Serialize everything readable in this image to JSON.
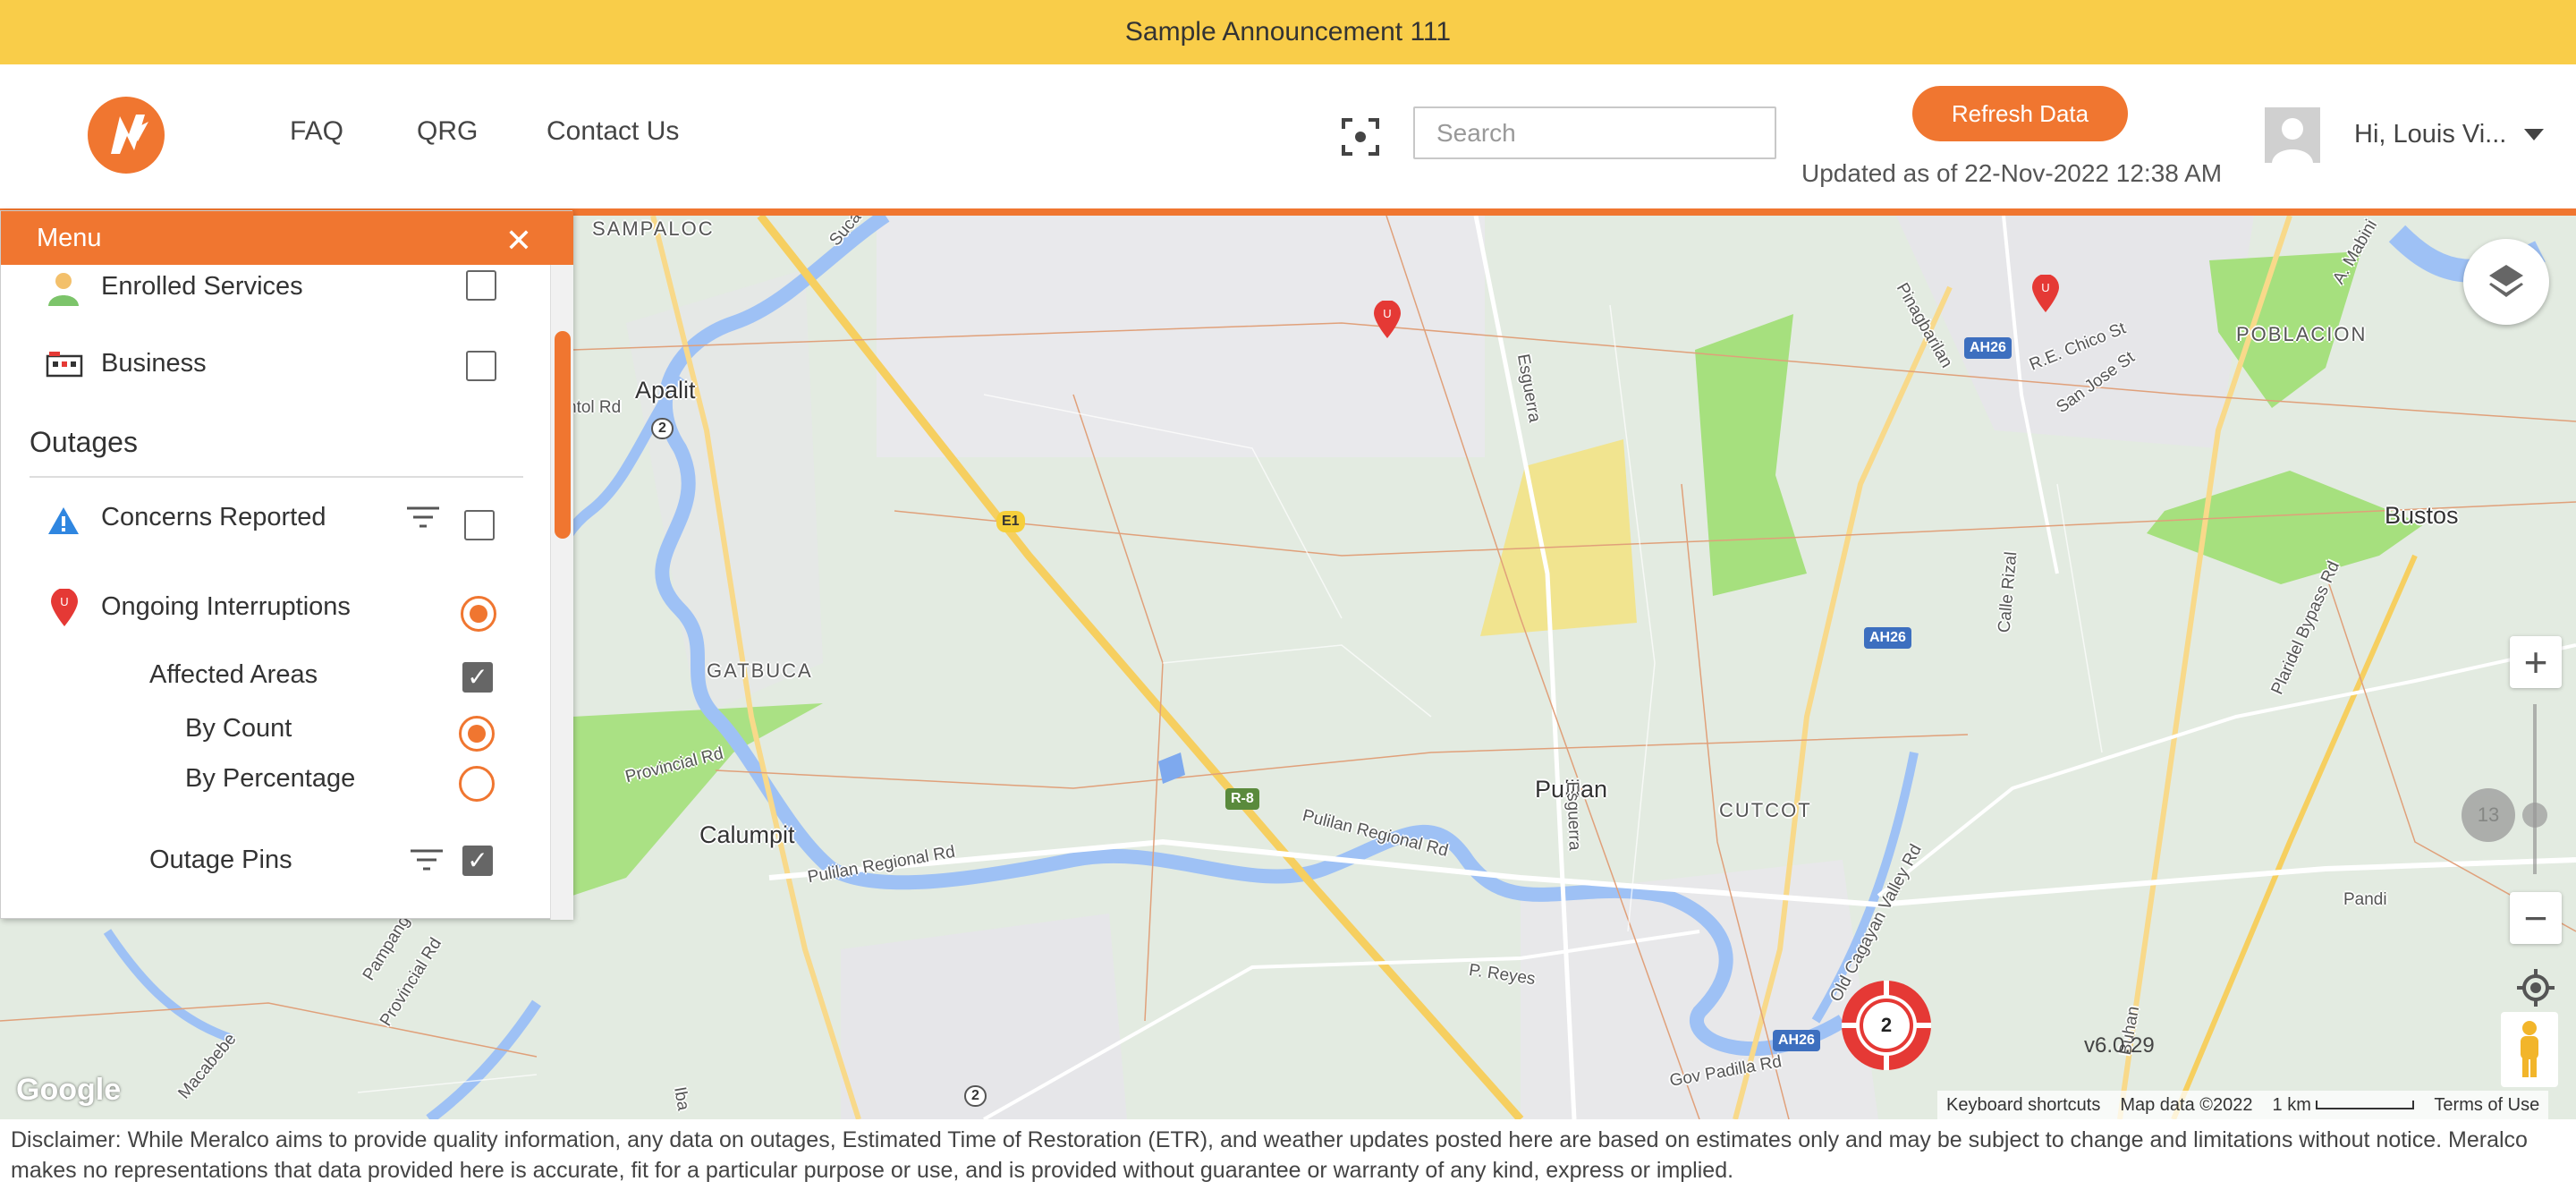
{
  "announcement": "Sample Announcement 111",
  "nav": {
    "faq": "FAQ",
    "qrg": "QRG",
    "contact": "Contact Us"
  },
  "search": {
    "placeholder": "Search",
    "value": ""
  },
  "refresh_label": "Refresh Data",
  "updated_text": "Updated as of 22-Nov-2022 12:38 AM",
  "user": {
    "greeting": "Hi, Louis Vi..."
  },
  "colors": {
    "brand_orange": "#f07630",
    "announcement_bg": "#f9cd49"
  },
  "icons": [
    "meralco-logo",
    "scan-icon",
    "avatar",
    "chevron-down-icon",
    "close-icon",
    "person-icon",
    "business-icon",
    "warning-icon",
    "filter-icon",
    "outage-pin-icon",
    "layers-icon",
    "locate-icon",
    "pegman-icon"
  ],
  "menu": {
    "title": "Menu",
    "items": {
      "enrolled": "Enrolled Services",
      "business": "Business"
    },
    "outages": {
      "title": "Outages",
      "concerns": "Concerns Reported",
      "ongoing": "Ongoing Interruptions",
      "affected": "Affected Areas",
      "by_count": "By Count",
      "by_percentage": "By Percentage",
      "pins": "Outage Pins"
    },
    "state": {
      "enrolled_checked": false,
      "business_checked": false,
      "concerns_checked": false,
      "ongoing_selected": true,
      "affected_checked": true,
      "mode": "By Count",
      "pins_checked": true
    }
  },
  "map": {
    "places": {
      "sampaloc": "SAMPALOC",
      "apalit": "Apalit",
      "gatbuca": "GATBUCA",
      "calumpit": "Calumpit",
      "pulilan": "Pulilan",
      "cutcot": "CUTCOT",
      "poblacion": "POBLACION",
      "bustos": "Bustos"
    },
    "roads": {
      "antol": "ntol Rd",
      "provincial1": "Provincial Rd",
      "provincial2": "Provincial Rd",
      "pulilan_regional1": "Pulilan Regional Rd",
      "pulilan_regional2": "Pulilan Regional Rd",
      "esguerra1": "Esguerra",
      "esguerra2": "Esguerra",
      "old_cagayan": "Old Cagayan Valley Rd",
      "calle_rizal": "Calle Rizal",
      "plaridel_bypass": "Plaridel Bypass Rd",
      "pandi": "Pandi",
      "p_reyes": "P. Reyes",
      "gov_padilla": "Gov Padilla Rd",
      "macabebe": "Macabebe",
      "pampang": "Pampang",
      "re_chico": "R.E. Chico St",
      "san_jose": "San Jose St",
      "pinagbarilan": "Pinagbarilan",
      "suca": "Suca",
      "iba": "Iba",
      "a_mabini": "A. Mabini",
      "bunan": "Buhan"
    },
    "shields": {
      "ah26_a": "AH26",
      "ah26_b": "AH26",
      "ah26_c": "AH26",
      "e1": "E1",
      "r8": "R-8",
      "r2_a": "2",
      "r2_b": "2"
    },
    "zoom_level": "13",
    "cluster_count": "2",
    "version": "v6.0.29",
    "google": "Google",
    "attribution": {
      "shortcuts": "Keyboard shortcuts",
      "mapdata": "Map data ©2022",
      "scale": "1 km",
      "terms": "Terms of Use"
    },
    "zoom_in": "+",
    "zoom_out": "−"
  },
  "disclaimer": "Disclaimer: While Meralco aims to provide quality information, any data on outages, Estimated Time of Restoration (ETR), and weather updates posted here are based on estimates only and may be subject to change and limitations without notice. Meralco makes no representations that data provided here is accurate, fit for a particular purpose or use, and is provided without guarantee or warranty of any kind, express or implied."
}
